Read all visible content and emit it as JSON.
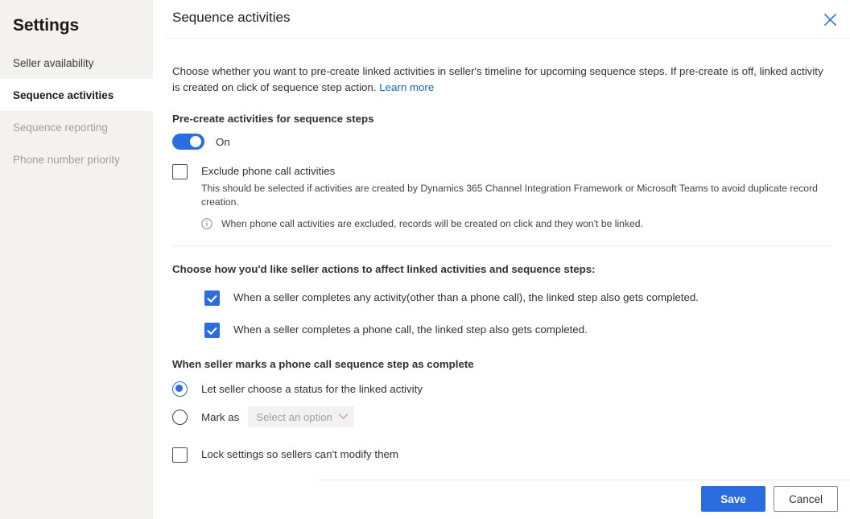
{
  "sidebar": {
    "title": "Settings",
    "items": [
      {
        "label": "Seller availability",
        "state": "normal"
      },
      {
        "label": "Sequence activities",
        "state": "active"
      },
      {
        "label": "Sequence reporting",
        "state": "disabled"
      },
      {
        "label": "Phone number priority",
        "state": "disabled"
      }
    ]
  },
  "panel": {
    "title": "Sequence activities",
    "close_icon": "close-icon",
    "description_part1": "Choose whether you want to pre-create linked activities in seller's timeline for upcoming sequence steps. If pre-create is off, linked activity is created on click of sequence step action.",
    "learn_more": "Learn more"
  },
  "precreate": {
    "label": "Pre-create activities for sequence steps",
    "toggle_state": "on",
    "toggle_label": "On"
  },
  "exclude": {
    "label": "Exclude phone call activities",
    "checked": false,
    "helper": "This should be selected if activities are created by Dynamics 365 Channel Integration Framework or Microsoft Teams to avoid duplicate record creation.",
    "info_icon": "info-icon",
    "info_text": "When phone call activities are excluded, records will be created on click and they won't be linked."
  },
  "seller_actions": {
    "heading": "Choose how you'd like seller actions to affect linked activities and sequence steps:",
    "options": [
      {
        "label": "When a seller completes any activity(other than a phone call), the linked step also gets completed.",
        "checked": true
      },
      {
        "label": "When a seller completes a phone call, the linked step also gets completed.",
        "checked": true
      }
    ]
  },
  "mark_complete": {
    "heading": "When seller marks a phone call sequence step as complete",
    "options": [
      {
        "label": "Let seller choose a status for the linked activity",
        "selected": true
      },
      {
        "label": "Mark as",
        "selected": false
      }
    ],
    "dropdown": {
      "placeholder": "Select an option",
      "value": "Select an option",
      "chevron_icon": "chevron-down-icon",
      "disabled": true
    }
  },
  "lock": {
    "label": "Lock settings so sellers can't modify them",
    "checked": false
  },
  "footer": {
    "save_label": "Save",
    "cancel_label": "Cancel"
  },
  "colors": {
    "accent": "#2b6ce0",
    "link": "#0f6cbd",
    "sidebar_bg": "#f3f2f1"
  }
}
